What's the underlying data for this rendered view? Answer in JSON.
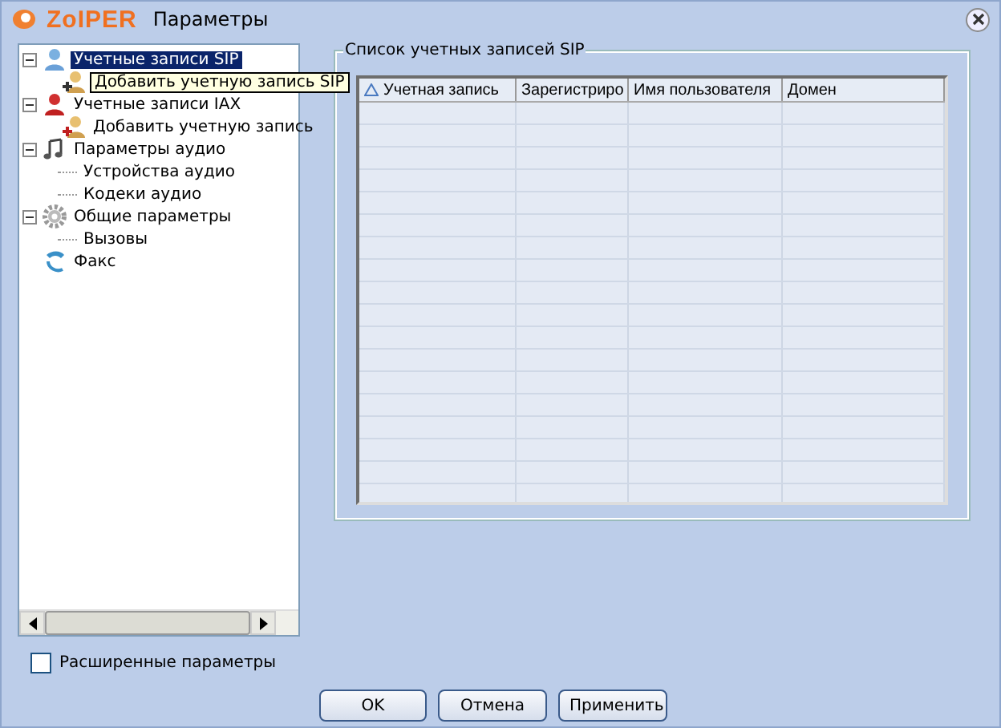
{
  "window": {
    "logo": "ZoIPER",
    "title": "Параметры"
  },
  "tree": [
    {
      "label": "Учетные записи SIP",
      "kind": "sip",
      "selected": true,
      "expanded": true,
      "children": [
        {
          "tooltip": "Добавить учетную запись SIP",
          "kind": "add-sip"
        }
      ]
    },
    {
      "label": "Учетные записи IAX",
      "kind": "iax",
      "selected": false,
      "expanded": true,
      "children": [
        {
          "label": "Добавить учетную запись",
          "kind": "add-iax",
          "selected": false
        }
      ]
    },
    {
      "label": "Параметры аудио",
      "kind": "audio",
      "selected": false,
      "expanded": true,
      "children": [
        {
          "label": "Устройства аудио",
          "selected": false
        },
        {
          "label": "Кодеки аудио",
          "selected": false
        }
      ]
    },
    {
      "label": "Общие параметры",
      "kind": "general",
      "selected": false,
      "expanded": true,
      "children": [
        {
          "label": "Вызовы",
          "selected": false
        }
      ]
    },
    {
      "label": "Факс",
      "kind": "fax",
      "selected": false
    }
  ],
  "group": {
    "title": "Список учетных записей SIP",
    "table": {
      "columns": [
        {
          "label": "Учетная запись",
          "sorted": true
        },
        {
          "label": "Зарегистриро",
          "sorted": false
        },
        {
          "label": "Имя пользователя",
          "sorted": false
        },
        {
          "label": "Домен",
          "sorted": false
        }
      ]
    }
  },
  "advanced": {
    "label": "Расширенные параметры",
    "checked": false
  },
  "buttons": [
    "OK",
    "Отмена",
    "Применить"
  ]
}
